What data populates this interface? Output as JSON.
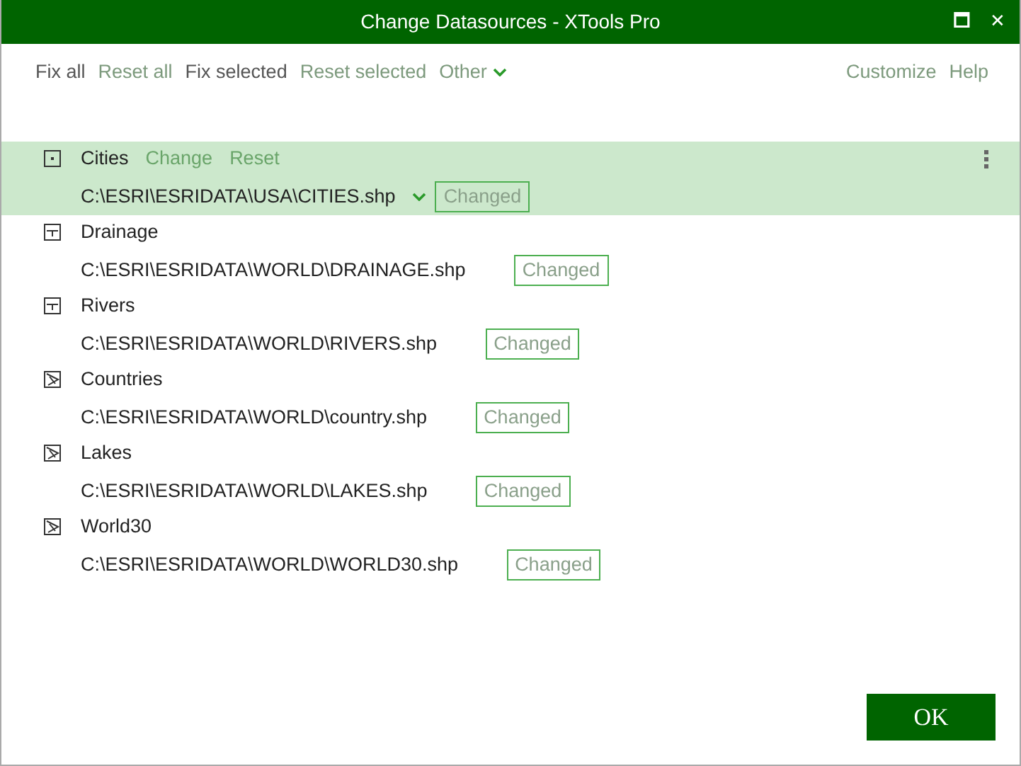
{
  "window": {
    "title": "Change Datasources - XTools Pro",
    "controls": [
      "🗖",
      "✕"
    ]
  },
  "toolbar": {
    "left": [
      {
        "label": "Fix all",
        "disabled": false
      },
      {
        "label": "Reset all",
        "disabled": true
      },
      {
        "label": "Fix selected",
        "disabled": false
      },
      {
        "label": "Reset selected",
        "disabled": true
      },
      {
        "label": "Other",
        "disabled": true,
        "kind": "dropdown"
      }
    ],
    "right": [
      {
        "label": "Customize"
      },
      {
        "label": "Help"
      }
    ]
  },
  "layers": [
    {
      "name": "Cities",
      "kind": "point",
      "path": "C:\\ESRI\\ESRIDATA\\USA\\CITIES.shp",
      "status": "Changed",
      "selected": true,
      "actions": [
        "Change",
        "Reset"
      ]
    },
    {
      "name": "Drainage",
      "kind": "line",
      "path": "C:\\ESRI\\ESRIDATA\\WORLD\\DRAINAGE.shp",
      "status": "Changed",
      "selected": false
    },
    {
      "name": "Rivers",
      "kind": "line",
      "path": "C:\\ESRI\\ESRIDATA\\WORLD\\RIVERS.shp",
      "status": "Changed",
      "selected": false
    },
    {
      "name": "Countries",
      "kind": "polygon",
      "path": "C:\\ESRI\\ESRIDATA\\WORLD\\country.shp",
      "status": "Changed",
      "selected": false
    },
    {
      "name": "Lakes",
      "kind": "polygon",
      "path": "C:\\ESRI\\ESRIDATA\\WORLD\\LAKES.shp",
      "status": "Changed",
      "selected": false
    },
    {
      "name": "World30",
      "kind": "polygon",
      "path": "C:\\ESRI\\ESRIDATA\\WORLD\\WORLD30.shp",
      "status": "Changed",
      "selected": false
    }
  ],
  "ok_button": "OK"
}
